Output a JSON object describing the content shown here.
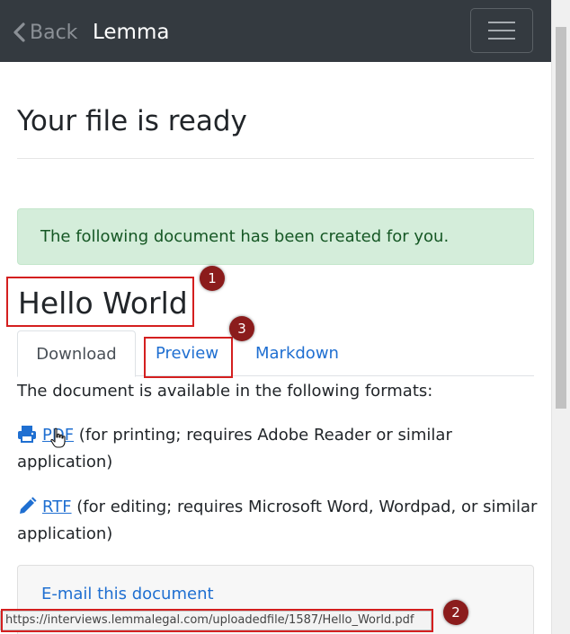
{
  "navbar": {
    "back_label": "Back",
    "brand": "Lemma",
    "back_icon": "chevron-left-icon",
    "menu_icon": "hamburger-menu-icon"
  },
  "page": {
    "title": "Your file is ready"
  },
  "alert": {
    "message": "The following document has been created for you."
  },
  "document": {
    "title": "Hello World",
    "tabs": [
      {
        "label": "Download",
        "active": true
      },
      {
        "label": "Preview",
        "active": false
      },
      {
        "label": "Markdown",
        "active": false
      }
    ],
    "intro": "The document is available in the following formats:",
    "formats": [
      {
        "icon": "printer-icon",
        "link": "PDF",
        "description": " (for printing; requires Adobe Reader or similar application)"
      },
      {
        "icon": "pencil-icon",
        "link": "RTF",
        "description": " (for editing; requires Microsoft Word, Wordpad, or similar application)"
      }
    ],
    "email_label": "E-mail this document"
  },
  "status_bar": {
    "url": "https://interviews.lemmalegal.com/uploadedfile/1587/Hello_World.pdf"
  },
  "annotations": [
    {
      "number": "1"
    },
    {
      "number": "2"
    },
    {
      "number": "3"
    }
  ],
  "colors": {
    "navbar_bg": "#343a40",
    "link": "#1f6fd1",
    "alert_bg": "#d4edda",
    "alert_text": "#155724",
    "highlight": "#d41f1f",
    "marker": "#8b1c1c"
  }
}
